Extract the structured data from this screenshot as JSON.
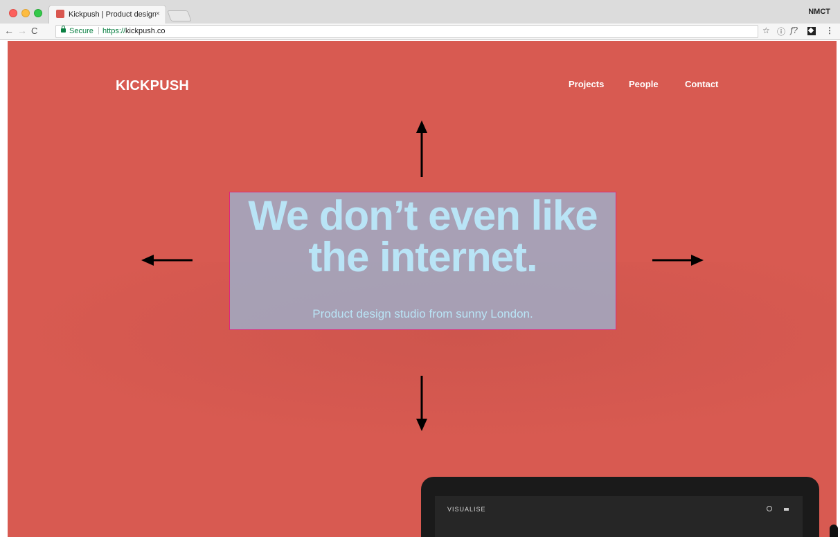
{
  "browser": {
    "tab_title": "Kickpush | Product design stu",
    "tab_close": "×",
    "profile_name": "NMCT",
    "secure_label": "Secure",
    "url_scheme": "https://",
    "url_host": "kickpush.co",
    "icons": {
      "back": "arrow-left-icon",
      "forward": "arrow-right-icon",
      "reload": "reload-icon",
      "bookmark": "star-icon",
      "info": "info-icon",
      "extension_f": "f-extension-icon",
      "extension_box": "extension-icon",
      "menu": "kebab-menu-icon"
    }
  },
  "site": {
    "logo": "KICKPUSH",
    "nav": [
      "Projects",
      "People",
      "Contact"
    ],
    "hero_line1": "We don’t even like",
    "hero_line2": "the internet.",
    "hero_subtitle": "Product design studio from sunny London.",
    "device_app_name": "VISUALISE",
    "colors": {
      "background": "#d85a51",
      "hero_text": "#b9e4f6",
      "hero_box_border": "#e0257a"
    }
  },
  "annotations": {
    "arrows": [
      "arrow-up",
      "arrow-left",
      "arrow-right",
      "arrow-down"
    ]
  }
}
